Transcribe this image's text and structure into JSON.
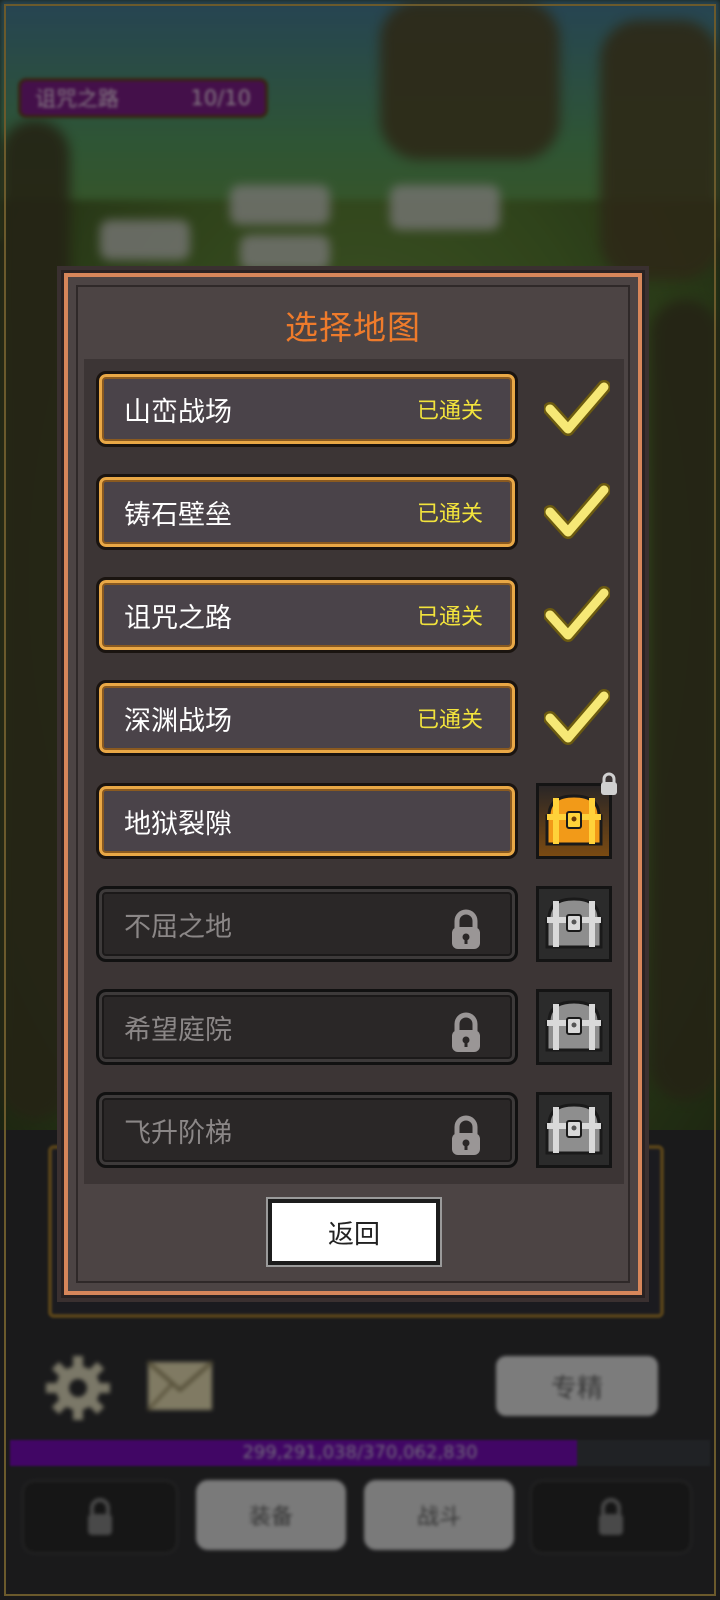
{
  "stage_badge": {
    "name": "诅咒之路",
    "progress": "10/10"
  },
  "modal": {
    "title": "选择地图",
    "back_label": "返回",
    "maps": [
      {
        "name": "山峦战场",
        "status": "已通关",
        "state": "cleared"
      },
      {
        "name": "铸石壁垒",
        "status": "已通关",
        "state": "cleared"
      },
      {
        "name": "诅咒之路",
        "status": "已通关",
        "state": "cleared"
      },
      {
        "name": "深渊战场",
        "status": "已通关",
        "state": "cleared"
      },
      {
        "name": "地狱裂隙",
        "status": "",
        "state": "current"
      },
      {
        "name": "不屈之地",
        "status": "",
        "state": "locked"
      },
      {
        "name": "希望庭院",
        "status": "",
        "state": "locked"
      },
      {
        "name": "飞升阶梯",
        "status": "",
        "state": "locked"
      }
    ]
  },
  "hud": {
    "specialize_label": "专精",
    "exp_text": "299,291,038/370,062,830",
    "exp_fraction": 0.81,
    "tabs": [
      "",
      "装备",
      "战斗",
      ""
    ]
  },
  "colors": {
    "title_orange": "#ef7b2b",
    "cleared_yellow": "#f2e33c",
    "gold_border": "#e9a846",
    "exp_purple": "#6a0aa4"
  },
  "icons": {
    "cleared": "check-icon",
    "current_reward": "treasure-chest-icon",
    "locked_reward": "locked-chest-icon",
    "locked_row": "padlock-icon"
  }
}
